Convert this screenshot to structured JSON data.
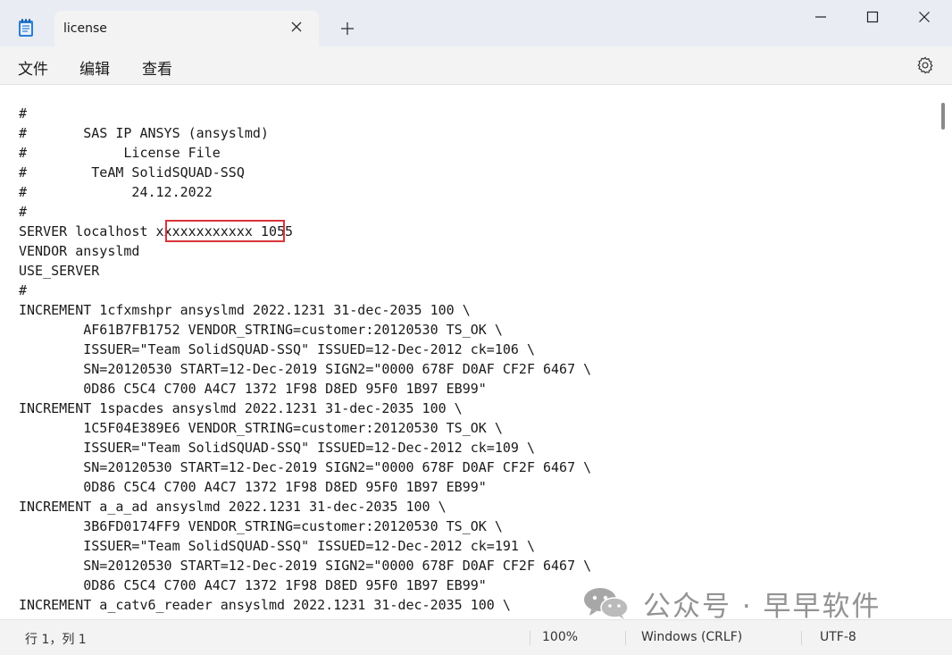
{
  "window": {
    "tab_title": "license",
    "icons": {
      "app": "notepad-icon",
      "close_tab": "close-icon",
      "new_tab": "plus-icon",
      "minimize": "minimize-icon",
      "maximize": "maximize-icon",
      "close": "close-icon"
    }
  },
  "menu": {
    "file": "文件",
    "edit": "编辑",
    "view": "查看",
    "settings_icon": "gear-icon"
  },
  "editor": {
    "content": "#\n#       SAS IP ANSYS (ansyslmd)\n#            License File\n#        TeAM SolidSQUAD-SSQ\n#             24.12.2022\n#\nSERVER localhost xxxxxxxxxxxx 1055\nVENDOR ansyslmd\nUSE_SERVER\n#\nINCREMENT 1cfxmshpr ansyslmd 2022.1231 31-dec-2035 100 \\\n        AF61B7FB1752 VENDOR_STRING=customer:20120530 TS_OK \\\n        ISSUER=\"Team SolidSQUAD-SSQ\" ISSUED=12-Dec-2012 ck=106 \\\n        SN=20120530 START=12-Dec-2019 SIGN2=\"0000 678F D0AF CF2F 6467 \\\n        0D86 C5C4 C700 A4C7 1372 1F98 D8ED 95F0 1B97 EB99\"\nINCREMENT 1spacdes ansyslmd 2022.1231 31-dec-2035 100 \\\n        1C5F04E389E6 VENDOR_STRING=customer:20120530 TS_OK \\\n        ISSUER=\"Team SolidSQUAD-SSQ\" ISSUED=12-Dec-2012 ck=109 \\\n        SN=20120530 START=12-Dec-2019 SIGN2=\"0000 678F D0AF CF2F 6467 \\\n        0D86 C5C4 C700 A4C7 1372 1F98 D8ED 95F0 1B97 EB99\"\nINCREMENT a_a_ad ansyslmd 2022.1231 31-dec-2035 100 \\\n        3B6FD0174FF9 VENDOR_STRING=customer:20120530 TS_OK \\\n        ISSUER=\"Team SolidSQUAD-SSQ\" ISSUED=12-Dec-2012 ck=191 \\\n        SN=20120530 START=12-Dec-2019 SIGN2=\"0000 678F D0AF CF2F 6467 \\\n        0D86 C5C4 C700 A4C7 1372 1F98 D8ED 95F0 1B97 EB99\"\nINCREMENT a_catv6_reader ansyslmd 2022.1231 31-dec-2035 100 \\",
    "highlight_color": "#d9343a"
  },
  "watermark": {
    "text": "公众号 · 早早软件",
    "icon": "wechat-icon"
  },
  "status": {
    "position": "行 1，列 1",
    "zoom": "100%",
    "line_ending": "Windows (CRLF)",
    "encoding": "UTF-8"
  }
}
